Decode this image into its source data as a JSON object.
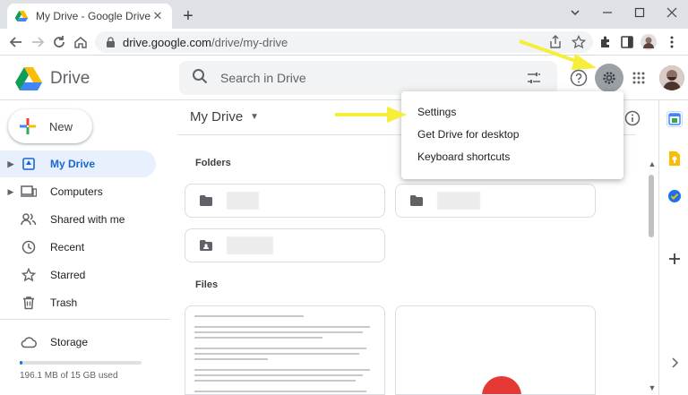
{
  "browser": {
    "tab_title": "My Drive - Google Drive",
    "url_host": "drive.google.com",
    "url_path": "/drive/my-drive"
  },
  "header": {
    "logo_text": "Drive",
    "search_placeholder": "Search in Drive"
  },
  "sidebar": {
    "new_label": "New",
    "items": [
      {
        "label": "My Drive",
        "icon": "my-drive-icon",
        "active": true
      },
      {
        "label": "Computers",
        "icon": "computers-icon"
      },
      {
        "label": "Shared with me",
        "icon": "shared-icon"
      },
      {
        "label": "Recent",
        "icon": "clock-icon"
      },
      {
        "label": "Starred",
        "icon": "star-icon"
      },
      {
        "label": "Trash",
        "icon": "trash-icon"
      }
    ],
    "storage_label": "Storage",
    "storage_used": "196.1 MB of 15 GB used",
    "storage_fraction": 0.013
  },
  "main": {
    "title": "My Drive",
    "folders_label": "Folders",
    "files_label": "Files"
  },
  "menu": {
    "items": [
      "Settings",
      "Get Drive for desktop",
      "Keyboard shortcuts"
    ]
  },
  "colors": {
    "accent": "#1a73e8",
    "annotation_arrow": "#f5ee3a"
  }
}
